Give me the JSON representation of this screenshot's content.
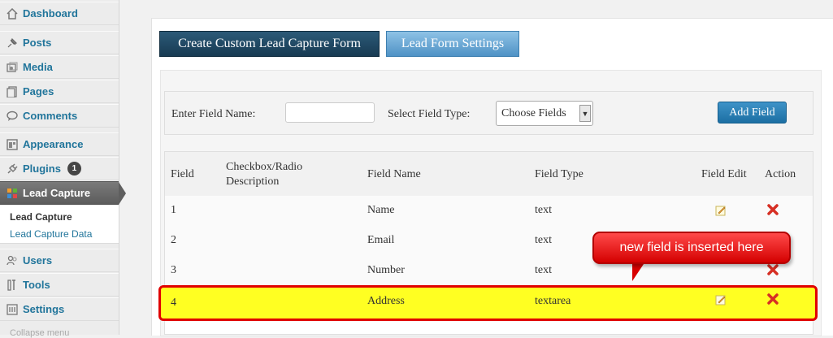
{
  "sidebar": {
    "items": [
      {
        "label": "Dashboard",
        "icon": "dashboard-icon"
      },
      {
        "label": "Posts",
        "icon": "posts-pin-icon"
      },
      {
        "label": "Media",
        "icon": "media-icon"
      },
      {
        "label": "Pages",
        "icon": "pages-icon"
      },
      {
        "label": "Comments",
        "icon": "comments-icon"
      },
      {
        "label": "Appearance",
        "icon": "appearance-icon"
      },
      {
        "label": "Plugins",
        "icon": "plugins-icon",
        "badge": "1"
      },
      {
        "label": "Lead Capture",
        "icon": "lead-capture-icon"
      },
      {
        "label": "Users",
        "icon": "users-icon"
      },
      {
        "label": "Tools",
        "icon": "tools-icon"
      },
      {
        "label": "Settings",
        "icon": "settings-icon"
      }
    ],
    "submenu": [
      {
        "label": "Lead Capture"
      },
      {
        "label": "Lead Capture Data"
      }
    ],
    "collapse_label": "Collapse menu"
  },
  "buttons": {
    "create_form": "Create Custom Lead Capture Form",
    "form_settings": "Lead Form Settings"
  },
  "field_form": {
    "field_name_label": "Enter Field Name:",
    "field_name_value": "",
    "field_type_label": "Select Field Type:",
    "field_type_selected": "Choose Fields",
    "add_button": "Add Field"
  },
  "table": {
    "headers": {
      "field": "Field",
      "description": "Checkbox/Radio Description",
      "name": "Field Name",
      "type": "Field Type",
      "edit": "Field Edit",
      "action": "Action"
    },
    "rows": [
      {
        "field": "1",
        "description": "",
        "name": "Name",
        "type": "text"
      },
      {
        "field": "2",
        "description": "",
        "name": "Email",
        "type": "text"
      },
      {
        "field": "3",
        "description": "",
        "name": "Number",
        "type": "text"
      },
      {
        "field": "4",
        "description": "",
        "name": "Address",
        "type": "textarea"
      }
    ]
  },
  "annotation": {
    "callout_text": "new field is inserted here"
  },
  "colors": {
    "link_blue": "#21759b",
    "dark_button": "#1d4460",
    "highlight_yellow": "#ffff22",
    "highlight_border": "#e00000",
    "callout_red": "#e81010",
    "delete_red": "#d62f24"
  }
}
